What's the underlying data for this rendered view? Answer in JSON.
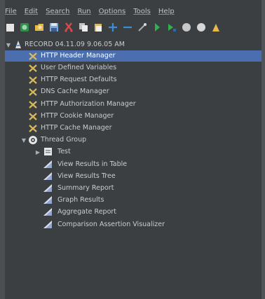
{
  "menu": [
    "File",
    "Edit",
    "Search",
    "Run",
    "Options",
    "Tools",
    "Help"
  ],
  "toolbar": [
    {
      "icon": "new-icon",
      "color": "#e0e0e0"
    },
    {
      "icon": "templates-icon",
      "color": "#3aa655"
    },
    {
      "icon": "open-icon",
      "color": "#e8b84a"
    },
    {
      "icon": "save-icon",
      "color": "#7fa7d9"
    },
    {
      "icon": "cut-icon",
      "color": "#d94a4a"
    },
    {
      "icon": "copy-icon",
      "color": "#e0e0e0"
    },
    {
      "icon": "paste-icon",
      "color": "#e8d48a"
    },
    {
      "icon": "expand-icon",
      "color": "#3b8ed6"
    },
    {
      "icon": "collapse-icon",
      "color": "#3b8ed6"
    },
    {
      "icon": "toggle-icon",
      "color": "#bfc3c6"
    },
    {
      "icon": "start-icon",
      "color": "#30b050"
    },
    {
      "icon": "start-no-pauses-icon",
      "color": "#30b050"
    },
    {
      "icon": "stop-icon",
      "color": "#c8c8c8"
    },
    {
      "icon": "shutdown-icon",
      "color": "#c8c8c8"
    },
    {
      "icon": "clear-icon",
      "color": "#e8b84a"
    }
  ],
  "tree": {
    "root": "RECORD 04.11.09 9.06.05 AM",
    "config_elements": [
      {
        "label": "HTTP Header Manager",
        "selected": true
      },
      {
        "label": "User Defined Variables",
        "selected": false
      },
      {
        "label": "HTTP Request Defaults",
        "selected": false
      },
      {
        "label": "DNS Cache Manager",
        "selected": false
      },
      {
        "label": "HTTP Authorization Manager",
        "selected": false
      },
      {
        "label": "HTTP Cookie Manager",
        "selected": false
      },
      {
        "label": "HTTP Cache Manager",
        "selected": false
      }
    ],
    "thread_group": "Thread Group",
    "controller": "Test",
    "listeners": [
      "View Results in Table",
      "View Results Tree",
      "Summary Report",
      "Graph Results",
      "Aggregate Report",
      "Comparison Assertion Visualizer"
    ]
  },
  "colors": {
    "selection": "#4b6eaf",
    "background": "#3c3f41"
  }
}
